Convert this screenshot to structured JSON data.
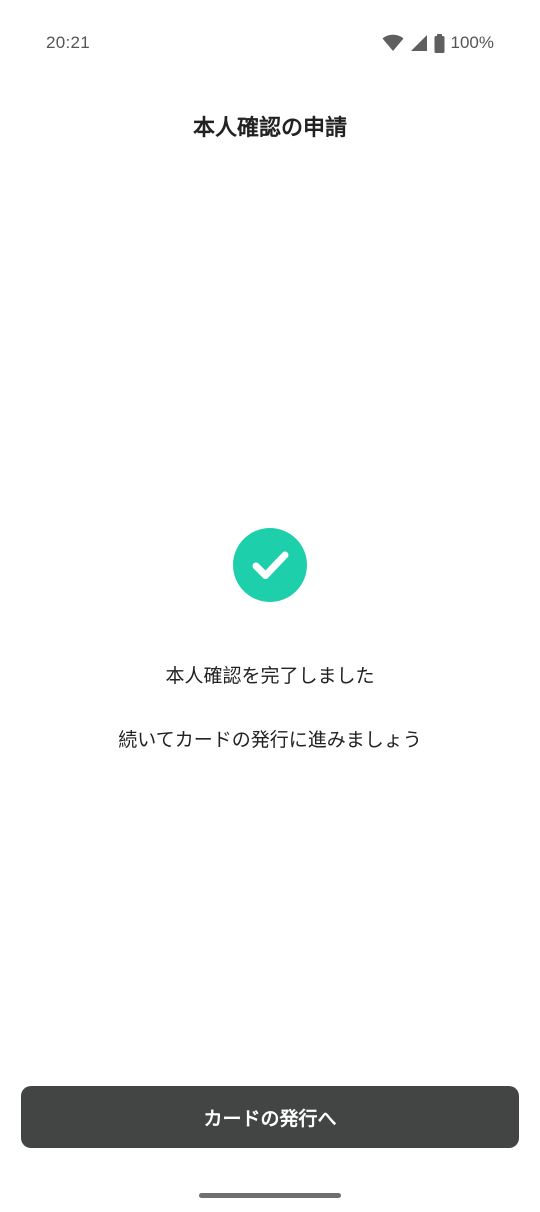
{
  "status_bar": {
    "time": "20:21",
    "battery_percent": "100%",
    "icons": [
      "wifi-icon",
      "signal-icon",
      "battery-icon"
    ]
  },
  "header": {
    "title": "本人確認の申請"
  },
  "main": {
    "status_icon": "check-circle-icon",
    "accent_color": "#1ecfac",
    "message_line_1": "本人確認を完了しました",
    "message_line_2": "続いてカードの発行に進みましょう"
  },
  "footer": {
    "primary_button_label": "カードの発行へ",
    "button_color": "#434545"
  }
}
